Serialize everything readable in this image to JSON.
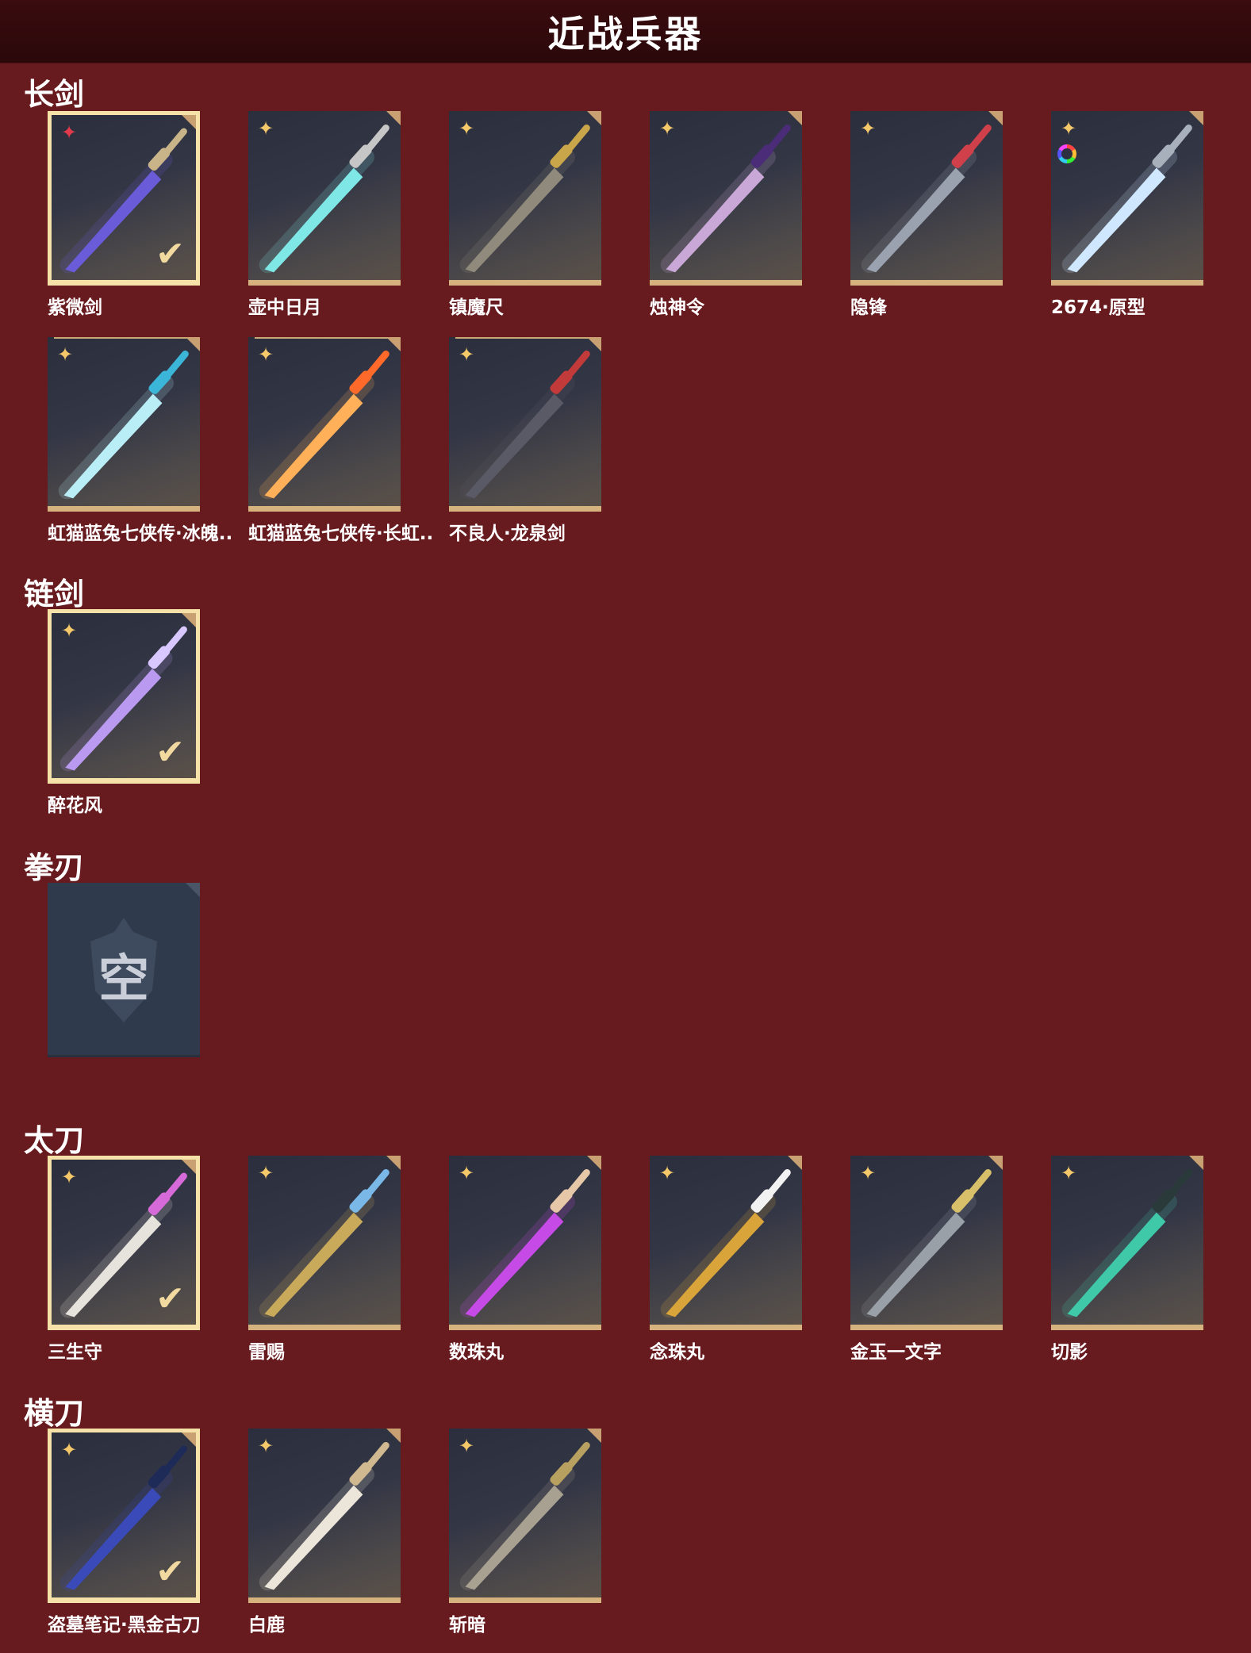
{
  "header": {
    "title": "近战兵器"
  },
  "sections": [
    {
      "title": "长剑",
      "items": [
        {
          "name": "紫微剑",
          "quality": "red-star",
          "selected": true,
          "blade": "#6a5bd8",
          "hilt": "#c9b48a"
        },
        {
          "name": "壶中日月",
          "quality": "gold-star",
          "blade": "#7fe7e6",
          "hilt": "#c6c6c6"
        },
        {
          "name": "镇魔尺",
          "quality": "gold-star",
          "blade": "#8f8a7b",
          "hilt": "#c9a64a"
        },
        {
          "name": "烛神令",
          "quality": "gold-star",
          "blade": "#c9a8d8",
          "hilt": "#4a2c78"
        },
        {
          "name": "隐锋",
          "quality": "gold-star",
          "blade": "#9aa2b0",
          "hilt": "#d0404a"
        },
        {
          "name": "2674·原型",
          "quality": "gold-star",
          "ring": true,
          "blade": "#cfe8ff",
          "hilt": "#a8b0bc"
        },
        {
          "name": "虹猫蓝兔七侠传·冰魄..",
          "quality": "gold-star",
          "stacked": true,
          "blade": "#b9eef6",
          "hilt": "#3bb6d8"
        },
        {
          "name": "虹猫蓝兔七侠传·长虹..",
          "quality": "gold-star",
          "stacked": true,
          "blade": "#ffb058",
          "hilt": "#ff6a2a"
        },
        {
          "name": "不良人·龙泉剑",
          "quality": "gold-star",
          "stacked": true,
          "blade": "#5a5a66",
          "hilt": "#c23a3a"
        }
      ]
    },
    {
      "title": "链剑",
      "items": [
        {
          "name": "醉花风",
          "quality": "gold-star",
          "selected": true,
          "blade": "#b99af0",
          "hilt": "#d8c8ff"
        }
      ]
    },
    {
      "title": "拳刃",
      "empty": true,
      "empty_text": "空"
    },
    {
      "title": "太刀",
      "items": [
        {
          "name": "三生守",
          "quality": "gold-star",
          "selected": true,
          "blade": "#e6e2dc",
          "hilt": "#d66ad8"
        },
        {
          "name": "雷赐",
          "quality": "gold-star",
          "blade": "#c9a95a",
          "hilt": "#7ab8e8"
        },
        {
          "name": "数珠丸",
          "quality": "gold-star",
          "blade": "#c64ae6",
          "hilt": "#e6c8a8"
        },
        {
          "name": "念珠丸",
          "quality": "gold-star",
          "blade": "#d9a43a",
          "hilt": "#f2f2f2"
        },
        {
          "name": "金玉一文字",
          "quality": "gold-star",
          "blade": "#9aa0a8",
          "hilt": "#d8c06a"
        },
        {
          "name": "切影",
          "quality": "gold-star",
          "blade": "#3fc9a8",
          "hilt": "#2a3a3a"
        }
      ]
    },
    {
      "title": "横刀",
      "items": [
        {
          "name": "盗墓笔记·黑金古刀",
          "quality": "gold-star",
          "selected": true,
          "blade": "#3a4ab8",
          "hilt": "#1e2a58"
        },
        {
          "name": "白鹿",
          "quality": "gold-star",
          "blade": "#ece6da",
          "hilt": "#d0b890"
        },
        {
          "name": "斩暗",
          "quality": "gold-star",
          "blade": "#a8a090",
          "hilt": "#b8a060"
        }
      ]
    }
  ],
  "icons": {
    "quality": "star-badge-icon",
    "selected": "checkmark-icon",
    "empty": "empty-slot-icon"
  }
}
